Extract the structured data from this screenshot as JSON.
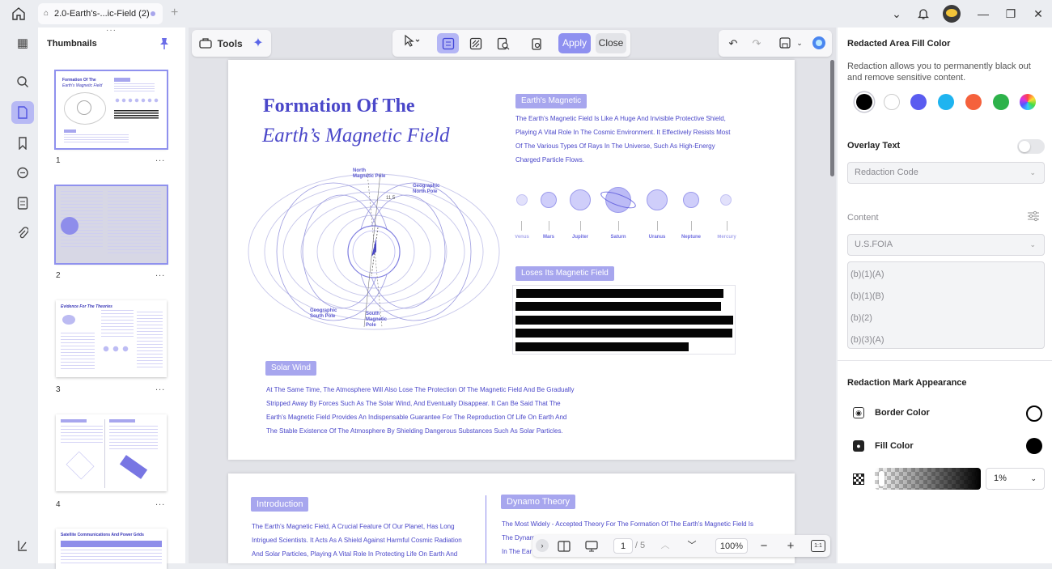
{
  "titlebar": {
    "tab_title": "2.0-Earth's-...ic-Field (2)",
    "new_tab": "+"
  },
  "rail": {
    "items": [
      "home",
      "thumbnails",
      "search",
      "pages",
      "bookmarks",
      "comments",
      "forms",
      "attachments",
      "layers"
    ]
  },
  "thumbnails": {
    "title": "Thumbnails",
    "pages": [
      {
        "num": "1",
        "more": "..."
      },
      {
        "num": "2",
        "more": "..."
      },
      {
        "num": "3",
        "more": "..."
      },
      {
        "num": "4",
        "more": "..."
      }
    ],
    "thumb3_title": "Evidence For The Theories",
    "thumb5_title": "Satellite Communications And Power Grids"
  },
  "toolbar": {
    "tools_label": "Tools",
    "apply_label": "Apply",
    "close_label": "Close"
  },
  "page1": {
    "title_line1": "Formation Of The",
    "title_line2": "Earth’s Magnetic Field",
    "diagram": {
      "north_magnetic": "North\nMagnetic Pole",
      "geographic_north": "Geographic\nNorth Pole",
      "angle": "11.5",
      "geographic_south": "Geographic\nSouth Pole",
      "south_magnetic": "South\nMagnetic\nPole"
    },
    "earth_tag": "Earth's Magnetic",
    "earth_text": [
      "The Earth's Magnetic Field Is Like A Huge And Invisible Protective Shield,",
      "Playing A Vital Role In The Cosmic Environment. It Effectively Resists Most",
      "Of The Various Types Of Rays In The Universe, Such As High-Energy",
      "Charged Particle Flows."
    ],
    "planets": [
      "Venus",
      "Mars",
      "Jupiter",
      "Saturn",
      "Uranus",
      "Neptune",
      "Mercury"
    ],
    "loses_tag": "Loses Its Magnetic Field",
    "solar_tag": "Solar Wind",
    "solar_text": [
      "At The Same Time, The Atmosphere Will Also Lose The Protection Of The Magnetic Field And Be Gradually",
      "Stripped Away By Forces Such As The Solar Wind, And Eventually Disappear. It Can Be Said That The",
      "Earth's Magnetic Field Provides An Indispensable Guarantee For The Reproduction Of Life On Earth And",
      "The Stable Existence Of The Atmosphere By Shielding Dangerous Substances Such As Solar Particles."
    ]
  },
  "page2": {
    "intro_tag": "Introduction",
    "intro_text": [
      "The Earth's Magnetic Field, A Crucial Feature Of Our Planet, Has Long",
      "Intrigued Scientists. It Acts As A Shield Against Harmful Cosmic Radiation",
      "And Solar Particles, Playing A Vital Role In Protecting Life On Earth And"
    ],
    "dynamo_tag": "Dynamo Theory",
    "dynamo_text": [
      "The Most Widely - Accepted Theory For The Formation Of The Earth's Magnetic Field Is",
      "The Dynam",
      "In The Ear"
    ]
  },
  "bottombar": {
    "page_current": "1",
    "page_total": "/ 5",
    "zoom": "100%",
    "fit": "1:1"
  },
  "panel": {
    "fill_title": "Redacted Area Fill Color",
    "fill_desc": "Redaction allows you to permanently black out and remove sensitive content.",
    "colors": [
      "#000000",
      "#ffffff",
      "#5a5cf0",
      "#1fb4f0",
      "#f5613c",
      "#2db24a",
      "rainbow"
    ],
    "overlay_title": "Overlay Text",
    "overlay_placeholder": "Redaction Code",
    "content_title": "Content",
    "content_select": "U.S.FOIA",
    "codes": [
      "(b)(1)(A)",
      "(b)(1)(B)",
      "(b)(2)",
      "(b)(3)(A)"
    ],
    "appearance_title": "Redaction Mark Appearance",
    "border_color_label": "Border Color",
    "fill_color_label": "Fill Color",
    "opacity_value": "1%"
  }
}
